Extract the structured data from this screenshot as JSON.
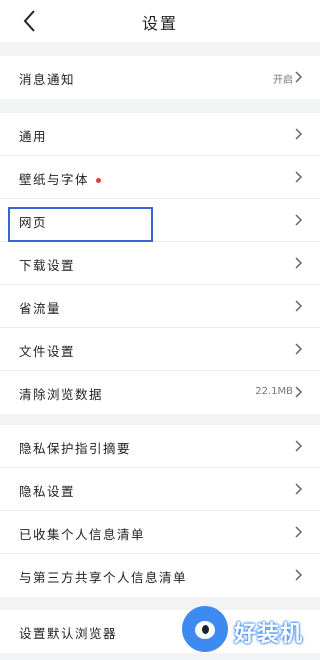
{
  "header": {
    "title": "设置"
  },
  "group1": [
    {
      "label": "消息通知",
      "value": "开启"
    }
  ],
  "group2": [
    {
      "label": "通用",
      "value": ""
    },
    {
      "label": "壁纸与字体",
      "value": ""
    },
    {
      "label": "网页",
      "value": ""
    },
    {
      "label": "下载设置",
      "value": ""
    },
    {
      "label": "省流量",
      "value": ""
    },
    {
      "label": "文件设置",
      "value": ""
    },
    {
      "label": "清除浏览数据",
      "value": "22.1MB"
    }
  ],
  "group3": [
    {
      "label": "隐私保护指引摘要"
    },
    {
      "label": "隐私设置"
    },
    {
      "label": "已收集个人信息清单"
    },
    {
      "label": "与第三方共享个人信息清单"
    }
  ],
  "group4": [
    {
      "label": "设置默认浏览器"
    }
  ],
  "watermark": {
    "text": "好装机"
  },
  "colors": {
    "accent": "#3a63d6",
    "badge": "#e53935",
    "background": "#f2f3f5"
  },
  "icons": {
    "back": "chevron-left-icon",
    "row": "chevron-right-icon"
  }
}
